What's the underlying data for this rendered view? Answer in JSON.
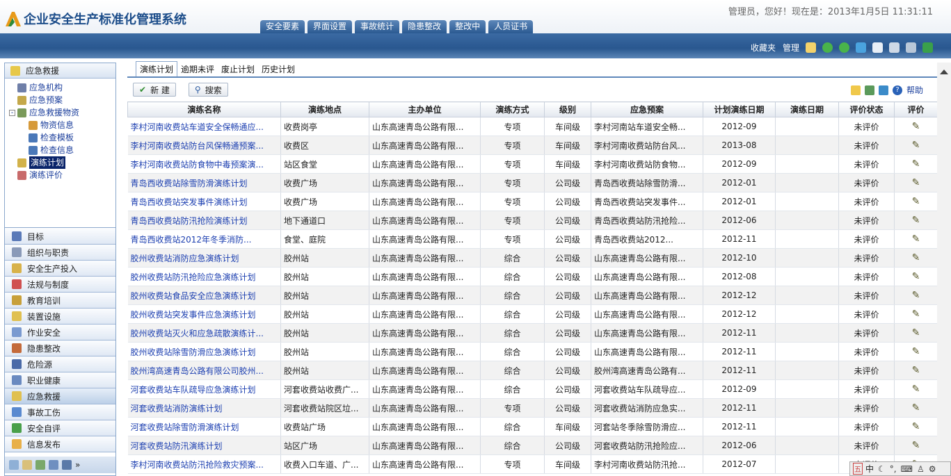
{
  "header": {
    "app_title": "企业安全生产标准化管理系统",
    "greeting": "管理员，您好！现在是：2013年1月5日  11:31:11",
    "tabs": [
      "安全要素",
      "界面设置",
      "事故统计",
      "隐患整改",
      "整改中",
      "人员证书"
    ]
  },
  "toolbar": {
    "favorites": "收藏夹",
    "manage": "管理",
    "icons": [
      "home-icon",
      "back-icon",
      "forward-icon",
      "refresh-icon",
      "edit-icon",
      "user-icon",
      "tools-icon",
      "exit-icon"
    ]
  },
  "leftpanel": {
    "title": "应急救援",
    "tree": [
      {
        "label": "应急机构",
        "level": 1,
        "icon": "org-icon"
      },
      {
        "label": "应急预案",
        "level": 1,
        "icon": "plan-icon"
      },
      {
        "label": "应急救援物资",
        "level": 1,
        "icon": "supplies-icon",
        "expanded": true
      },
      {
        "label": "物资信息",
        "level": 2,
        "icon": "info-icon"
      },
      {
        "label": "检查模板",
        "level": 2,
        "icon": "template-icon"
      },
      {
        "label": "检查信息",
        "level": 2,
        "icon": "check-icon"
      },
      {
        "label": "演练计划",
        "level": 1,
        "icon": "drill-plan-icon",
        "selected": true
      },
      {
        "label": "演练评价",
        "level": 1,
        "icon": "drill-eval-icon"
      }
    ],
    "menu": [
      "目标",
      "组织与职责",
      "安全生产投入",
      "法规与制度",
      "教育培训",
      "装置设施",
      "作业安全",
      "隐患整改",
      "危险源",
      "职业健康",
      "应急救援",
      "事故工伤",
      "安全自评",
      "信息发布"
    ],
    "active_menu": "应急救援"
  },
  "main": {
    "subtabs": [
      "演练计划",
      "逾期未评",
      "废止计划",
      "历史计划"
    ],
    "new_button": "新 建",
    "search_button": "搜索",
    "help": "帮助",
    "columns": [
      "演练名称",
      "演练地点",
      "主办单位",
      "演练方式",
      "级别",
      "应急预案",
      "计划演练日期",
      "演练日期",
      "评价状态",
      "评价"
    ],
    "rows": [
      [
        "李村河南收费站车道安全保畅通应...",
        "收费岗亭",
        "山东高速青岛公路有限...",
        "专项",
        "车间级",
        "李村河南站车道安全畅...",
        "2012-09",
        "",
        "未评价"
      ],
      [
        "李村河南收费站防台风保畅通预案...",
        "收费区",
        "山东高速青岛公路有限...",
        "专项",
        "车间级",
        "李村河南收费站防台风...",
        "2013-08",
        "",
        "未评价"
      ],
      [
        "李村河南收费站防食物中毒预案演...",
        "站区食堂",
        "山东高速青岛公路有限...",
        "专项",
        "车间级",
        "李村河南收费站防食物...",
        "2012-09",
        "",
        "未评价"
      ],
      [
        "青岛西收费站除雪防滑演练计划",
        "收费广场",
        "山东高速青岛公路有限...",
        "专项",
        "公司级",
        "青岛西收费站除雪防滑...",
        "2012-01",
        "",
        "未评价"
      ],
      [
        "青岛西收费站突发事件演练计划",
        "收费广场",
        "山东高速青岛公路有限...",
        "专项",
        "公司级",
        "青岛西收费站突发事件...",
        "2012-01",
        "",
        "未评价"
      ],
      [
        "青岛西收费站防汛抢险演练计划",
        "地下通道口",
        "山东高速青岛公路有限...",
        "专项",
        "公司级",
        "青岛西收费站防汛抢险...",
        "2012-06",
        "",
        "未评价"
      ],
      [
        "青岛西收费站2012年冬季消防...",
        "食堂、庭院",
        "山东高速青岛公路有限...",
        "专项",
        "公司级",
        "青岛西收费站2012...",
        "2012-11",
        "",
        "未评价"
      ],
      [
        "胶州收费站消防应急演练计划",
        "胶州站",
        "山东高速青岛公路有限...",
        "综合",
        "公司级",
        "山东高速青岛公路有限...",
        "2012-10",
        "",
        "未评价"
      ],
      [
        "胶州收费站防汛抢险应急演练计划",
        "胶州站",
        "山东高速青岛公路有限...",
        "综合",
        "公司级",
        "山东高速青岛公路有限...",
        "2012-08",
        "",
        "未评价"
      ],
      [
        "胶州收费站食品安全应急演练计划",
        "胶州站",
        "山东高速青岛公路有限...",
        "综合",
        "公司级",
        "山东高速青岛公路有限...",
        "2012-12",
        "",
        "未评价"
      ],
      [
        "胶州收费站突发事件应急演练计划",
        "胶州站",
        "山东高速青岛公路有限...",
        "综合",
        "公司级",
        "山东高速青岛公路有限...",
        "2012-12",
        "",
        "未评价"
      ],
      [
        "胶州收费站灭火和应急疏散演练计...",
        "胶州站",
        "山东高速青岛公路有限...",
        "综合",
        "公司级",
        "山东高速青岛公路有限...",
        "2012-11",
        "",
        "未评价"
      ],
      [
        "胶州收费站除雪防滑应急演练计划",
        "胶州站",
        "山东高速青岛公路有限...",
        "综合",
        "公司级",
        "山东高速青岛公路有限...",
        "2012-11",
        "",
        "未评价"
      ],
      [
        "胶州湾高速青岛公路有限公司胶州...",
        "胶州站",
        "山东高速青岛公路有限...",
        "综合",
        "公司级",
        "胶州湾高速青岛公路有...",
        "2012-11",
        "",
        "未评价"
      ],
      [
        "河套收费站车队疏导应急演练计划",
        "河套收费站收费广...",
        "山东高速青岛公路有限...",
        "综合",
        "公司级",
        "河套收费站车队疏导应...",
        "2012-09",
        "",
        "未评价"
      ],
      [
        "河套收费站消防演练计划",
        "河套收费站院区垃...",
        "山东高速青岛公路有限...",
        "专项",
        "公司级",
        "河套收费站消防应急实...",
        "2012-11",
        "",
        "未评价"
      ],
      [
        "河套收费站除雪防滑演练计划",
        "收费站广场",
        "山东高速青岛公路有限...",
        "综合",
        "车间级",
        "河套站冬季除雪防滑应...",
        "2012-11",
        "",
        "未评价"
      ],
      [
        "河套收费站防汛演练计划",
        "站区广场",
        "山东高速青岛公路有限...",
        "综合",
        "公司级",
        "河套收费站防汛抢险应...",
        "2012-06",
        "",
        "未评价"
      ],
      [
        "李村河南收费站防汛抢险救灾预案...",
        "收费入口车道、广...",
        "山东高速青岛公路有限...",
        "专项",
        "车间级",
        "李村河南收费站防汛抢...",
        "2012-07",
        "",
        "未评价"
      ]
    ]
  },
  "ime": "中"
}
